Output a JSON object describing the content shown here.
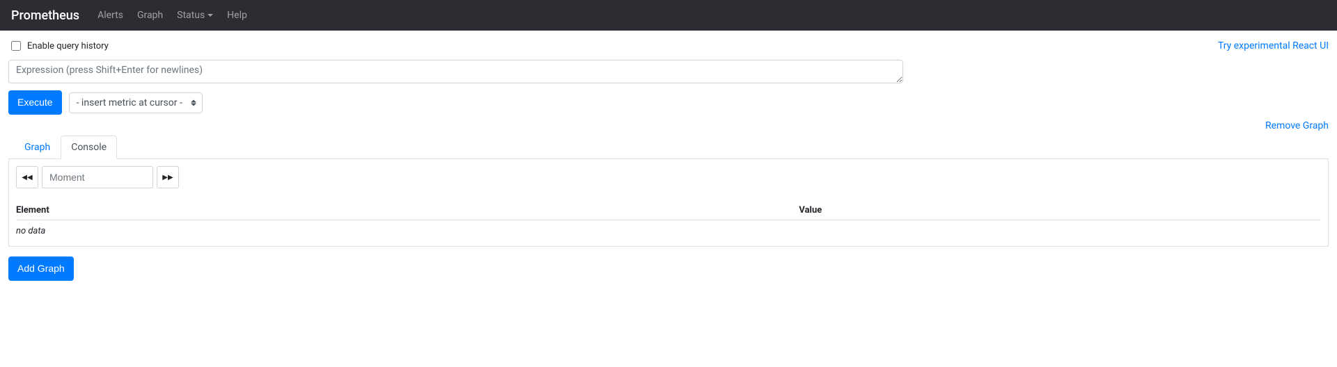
{
  "navbar": {
    "brand": "Prometheus",
    "alerts": "Alerts",
    "graph": "Graph",
    "status": "Status",
    "help": "Help"
  },
  "top": {
    "history_label": "Enable query history",
    "react_link": "Try experimental React UI"
  },
  "expr": {
    "placeholder": "Expression (press Shift+Enter for newlines)",
    "value": ""
  },
  "actions": {
    "execute": "Execute",
    "metric_select": "- insert metric at cursor -",
    "remove_graph": "Remove Graph",
    "add_graph": "Add Graph"
  },
  "tabs": {
    "graph": "Graph",
    "console": "Console"
  },
  "moment": {
    "placeholder": "Moment",
    "value": ""
  },
  "table": {
    "element_header": "Element",
    "value_header": "Value",
    "no_data": "no data"
  }
}
